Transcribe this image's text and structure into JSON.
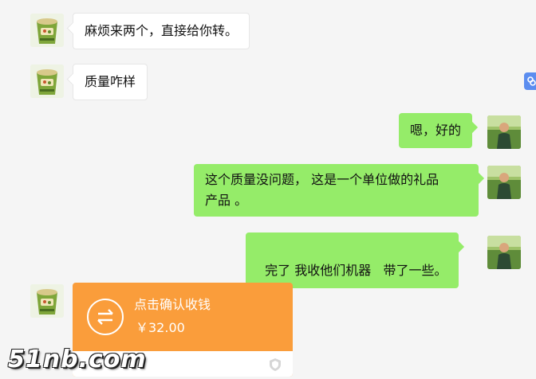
{
  "messages": [
    {
      "side": "in",
      "text": "麻烦来两个，直接给你转。"
    },
    {
      "side": "in",
      "text": "质量咋样"
    },
    {
      "side": "out",
      "text": "嗯，好的"
    },
    {
      "side": "out",
      "text_line1": "这个质量没问题， 这是一个单位做的礼品",
      "text_line2": "产品 。"
    },
    {
      "side": "out",
      "text": "完了 我收他们机器   带了一些。"
    }
  ],
  "transfer": {
    "title": "点击确认收钱",
    "amount": "￥32.00"
  },
  "watermark": "51nb.com",
  "colors": {
    "background": "#f5f5f5",
    "incoming_bubble": "#ffffff",
    "outgoing_bubble": "#95ec69",
    "transfer_card": "#fa9d3b"
  },
  "icons": [
    "cup-noodle-avatar",
    "man-avatar",
    "transfer-arrows-icon",
    "shield-icon",
    "side-link-icon"
  ]
}
